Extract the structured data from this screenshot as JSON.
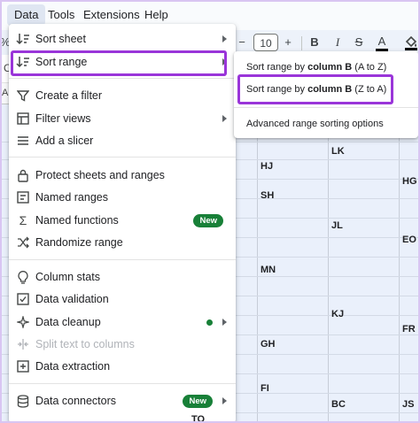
{
  "menubar": {
    "items": [
      "Data",
      "Tools",
      "Extensions",
      "Help"
    ]
  },
  "toolbar": {
    "left_fragment": "%",
    "decrease": "−",
    "font_size": "10",
    "increase": "+",
    "bold": "B",
    "italic": "I",
    "strikethrough": "S",
    "text_color": "A"
  },
  "formula": {
    "name_fragment": "C"
  },
  "grid": {
    "col_fragment": "A",
    "cells": [
      {
        "text": "LK"
      },
      {
        "text": "HJ"
      },
      {
        "text": "HG"
      },
      {
        "text": "SH"
      },
      {
        "text": "JL"
      },
      {
        "text": "EO"
      },
      {
        "text": "MN"
      },
      {
        "text": "KJ"
      },
      {
        "text": "FR"
      },
      {
        "text": "GH"
      },
      {
        "text": "FI"
      },
      {
        "text": "BC"
      },
      {
        "text": "JS"
      },
      {
        "text": "TO"
      }
    ]
  },
  "data_menu": {
    "sort_sheet": "Sort sheet",
    "sort_range": "Sort range",
    "create_filter": "Create a filter",
    "filter_views": "Filter views",
    "add_slicer": "Add a slicer",
    "protect": "Protect sheets and ranges",
    "named_ranges": "Named ranges",
    "named_functions": "Named functions",
    "randomize": "Randomize range",
    "column_stats": "Column stats",
    "data_validation": "Data validation",
    "data_cleanup": "Data cleanup",
    "split_text": "Split text to columns",
    "data_extraction": "Data extraction",
    "data_connectors": "Data connectors",
    "new_badge": "New"
  },
  "sort_submenu": {
    "az_prefix": "Sort range by ",
    "az_bold": "column B",
    "az_suffix": " (A to Z)",
    "za_prefix": "Sort range by ",
    "za_bold": "column B",
    "za_suffix": " (Z to A)",
    "advanced": "Advanced range sorting options"
  },
  "colors": {
    "highlight": "#9a35d9",
    "badge": "#188038",
    "selected_range": "#eaf0fb"
  }
}
